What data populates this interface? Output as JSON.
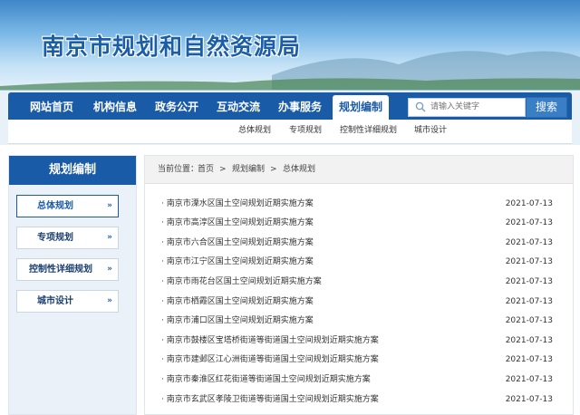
{
  "header": {
    "site_title": "南京市规划和自然资源局"
  },
  "nav": {
    "items": [
      {
        "label": "网站首页"
      },
      {
        "label": "机构信息"
      },
      {
        "label": "政务公开"
      },
      {
        "label": "互动交流"
      },
      {
        "label": "办事服务"
      },
      {
        "label": "规划编制",
        "active": true
      }
    ],
    "search_placeholder": "请输入关键字",
    "search_button": "搜索"
  },
  "subnav": {
    "items": [
      {
        "label": "总体规划"
      },
      {
        "label": "专项规划"
      },
      {
        "label": "控制性详细规划"
      },
      {
        "label": "城市设计"
      }
    ]
  },
  "sidebar": {
    "title": "规划编制",
    "items": [
      {
        "label": "总体规划",
        "active": true
      },
      {
        "label": "专项规划"
      },
      {
        "label": "控制性详细规划"
      },
      {
        "label": "城市设计"
      }
    ],
    "arrow_glyph": "»"
  },
  "breadcrumb": {
    "prefix": "当前位置：",
    "items": [
      "首页",
      "规划编制",
      "总体规划"
    ],
    "separator": ">"
  },
  "articles": [
    {
      "title": "· 南京市溧水区国土空间规划近期实施方案",
      "date": "2021-07-13"
    },
    {
      "title": "· 南京市高淳区国土空间规划近期实施方案",
      "date": "2021-07-13"
    },
    {
      "title": "· 南京市六合区国土空间规划近期实施方案",
      "date": "2021-07-13"
    },
    {
      "title": "· 南京市江宁区国土空间规划近期实施方案",
      "date": "2021-07-13"
    },
    {
      "title": "· 南京市雨花台区国土空间规划近期实施方案",
      "date": "2021-07-13"
    },
    {
      "title": "· 南京市栖霞区国土空间规划近期实施方案",
      "date": "2021-07-13"
    },
    {
      "title": "· 南京市浦口区国土空间规划近期实施方案",
      "date": "2021-07-13"
    },
    {
      "title": "· 南京市鼓楼区宝塔桥街道等街道国土空间规划近期实施方案",
      "date": "2021-07-13"
    },
    {
      "title": "· 南京市建邺区江心洲街道等街道国土空间规划近期实施方案",
      "date": "2021-07-13"
    },
    {
      "title": "· 南京市秦淮区红花街道等街道国土空间规划近期实施方案",
      "date": "2021-07-13"
    },
    {
      "title": "· 南京市玄武区孝陵卫街道等街道国土空间规划近期实施方案",
      "date": "2021-07-13"
    }
  ],
  "colors": {
    "nav_blue": "#1a5ba8",
    "banner_sky": "#79b7e6"
  }
}
